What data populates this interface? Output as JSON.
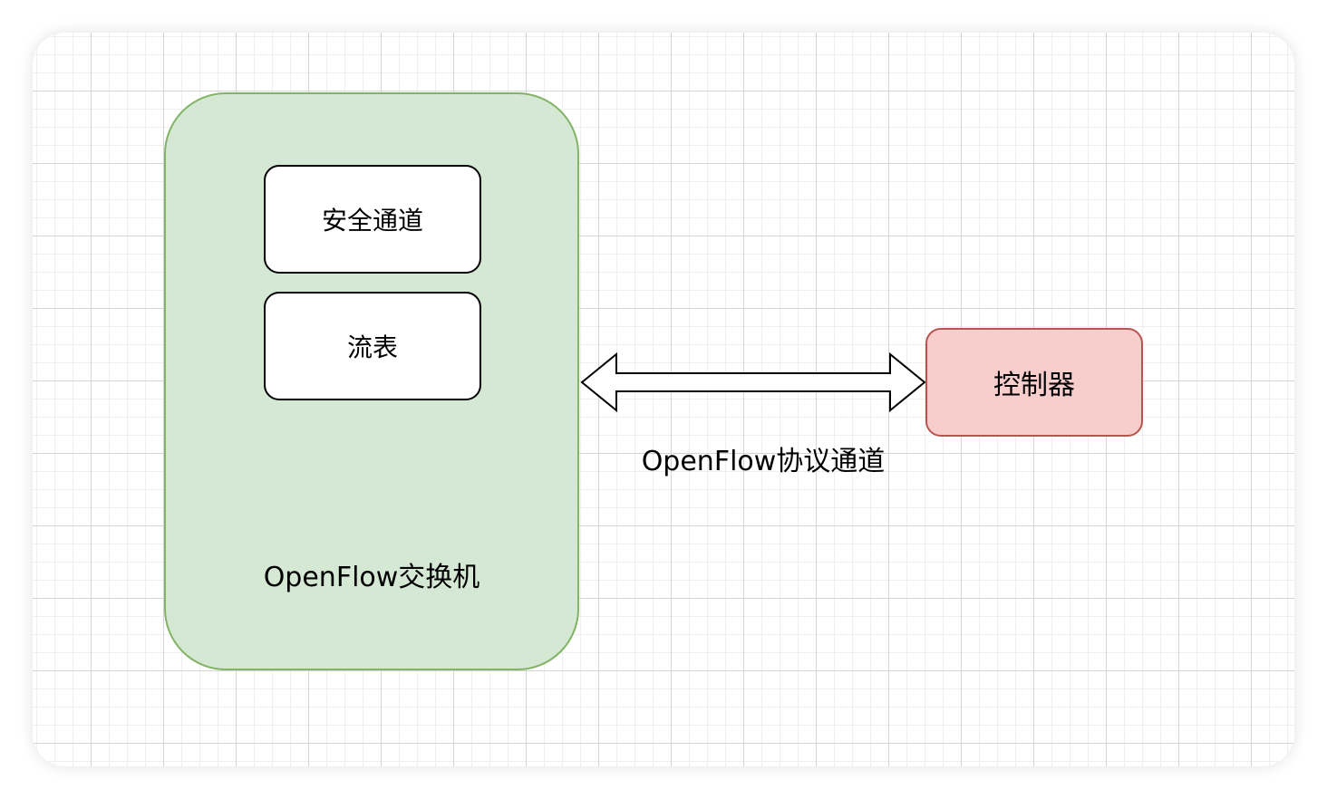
{
  "switch": {
    "label": "OpenFlow交换机",
    "components": [
      {
        "label": "安全通道"
      },
      {
        "label": "流表"
      }
    ],
    "fill_color": "#d5e8d4",
    "border_color": "#82b366"
  },
  "controller": {
    "label": "控制器",
    "fill_color": "#f8cecc",
    "border_color": "#b85450"
  },
  "connection": {
    "label": "OpenFlow协议通道",
    "type": "bidirectional"
  }
}
